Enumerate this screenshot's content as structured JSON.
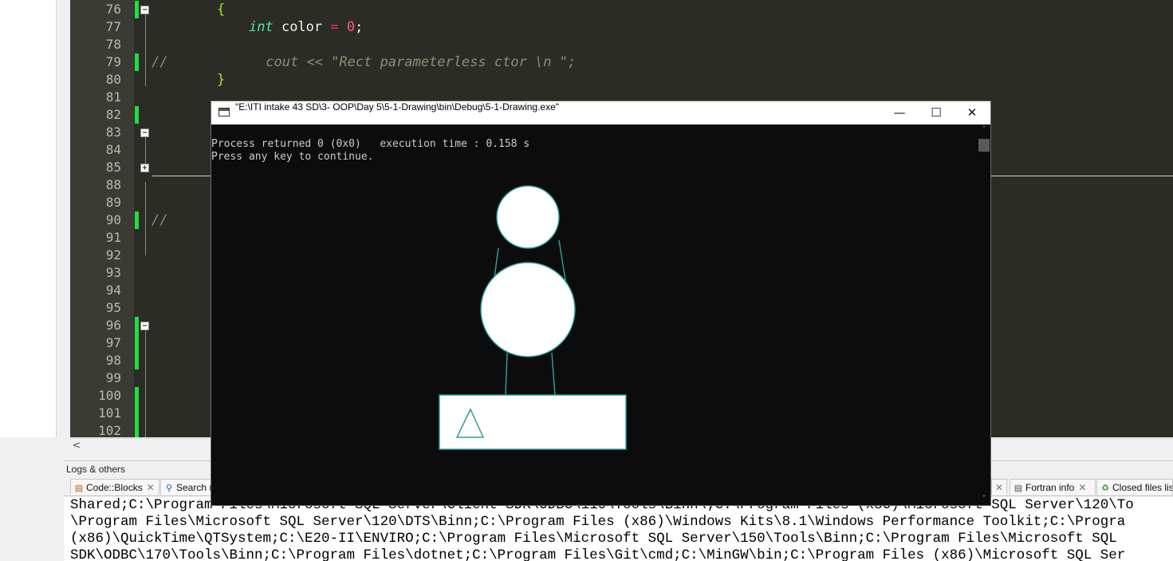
{
  "editor": {
    "lines": [
      {
        "num": "76",
        "code": [
          {
            "t": "{",
            "c": "br"
          }
        ]
      },
      {
        "num": "77",
        "code": [
          {
            "t": "int",
            "c": "kw"
          },
          {
            "t": " color ",
            "c": "pl"
          },
          {
            "t": "=",
            "c": "op"
          },
          {
            "t": " ",
            "c": "pl"
          },
          {
            "t": "0",
            "c": "num"
          },
          {
            "t": ";",
            "c": "pl"
          }
        ]
      },
      {
        "num": "78",
        "code": []
      },
      {
        "num": "79",
        "code": [
          {
            "t": "//            cout << \"Rect parameterless ctor \\n \";",
            "c": "cm"
          }
        ]
      },
      {
        "num": "80",
        "code": [
          {
            "t": "}",
            "c": "br"
          }
        ]
      },
      {
        "num": "81",
        "code": []
      },
      {
        "num": "82",
        "code": []
      },
      {
        "num": "83",
        "code": []
      },
      {
        "num": "84",
        "code": []
      },
      {
        "num": "85",
        "code": []
      },
      {
        "num": "88",
        "code": []
      },
      {
        "num": "89",
        "code": []
      },
      {
        "num": "90",
        "code": [
          {
            "t": "//",
            "c": "cm"
          }
        ]
      },
      {
        "num": "91",
        "code": []
      },
      {
        "num": "92",
        "code": []
      },
      {
        "num": "93",
        "code": []
      },
      {
        "num": "94",
        "code": []
      },
      {
        "num": "95",
        "code": []
      },
      {
        "num": "96",
        "code": []
      },
      {
        "num": "97",
        "code": []
      },
      {
        "num": "98",
        "code": []
      },
      {
        "num": "99",
        "code": []
      },
      {
        "num": "100",
        "code": []
      },
      {
        "num": "101",
        "code": []
      },
      {
        "num": "102",
        "code": []
      }
    ],
    "hscroll_arrow": "<"
  },
  "console": {
    "title": "\"E:\\ITI intake 43 SD\\3- OOP\\Day 5\\5-1-Drawing\\bin\\Debug\\5-1-Drawing.exe\"",
    "minimize": "—",
    "maximize": "☐",
    "close": "✕",
    "output": [
      "Process returned 0 (0x0)   execution time : 0.158 s",
      "Press any key to continue."
    ],
    "scroll_up": "˄",
    "scroll_down": "˅"
  },
  "logs": {
    "panel_title": "Logs & others",
    "tabs": [
      {
        "label": "Code::Blocks",
        "icon": "document-icon"
      },
      {
        "label": "Search r",
        "icon": "search-icon"
      },
      {
        "label": "Fortran info",
        "icon": "document-icon"
      },
      {
        "label": "Closed files lis",
        "icon": "recycle-icon"
      }
    ],
    "text_lines": [
      "Shared;C:\\Program Files\\Microsoft SQL Server\\Client SDK\\ODBC\\110\\Tools\\Binn\\;C:\\Program Files (x86)\\Microsoft SQL Server\\120\\To",
      "\\Program Files\\Microsoft SQL Server\\120\\DTS\\Binn;C:\\Program Files (x86)\\Windows Kits\\8.1\\Windows Performance Toolkit;C:\\Progra",
      "(x86)\\QuickTime\\QTSystem;C:\\E20-II\\ENVIRO;C:\\Program Files\\Microsoft SQL Server\\150\\Tools\\Binn;C:\\Program Files\\Microsoft SQL",
      "SDK\\ODBC\\170\\Tools\\Binn;C:\\Program Files\\dotnet;C:\\Program Files\\Git\\cmd;C:\\MinGW\\bin;C:\\Program Files (x86)\\Microsoft SQL Ser"
    ]
  }
}
